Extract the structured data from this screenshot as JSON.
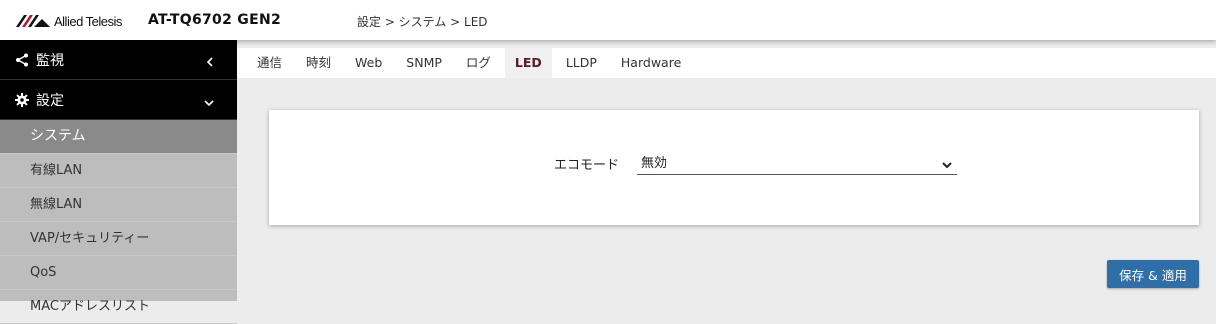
{
  "header": {
    "logo_text": "Allied Telesis",
    "model": "AT-TQ6702 GEN2",
    "breadcrumb": "設定 > システム > LED"
  },
  "sidebar": {
    "groups": [
      {
        "label": "監視",
        "icon": "share-icon",
        "chevron": "chevron-left-icon"
      },
      {
        "label": "設定",
        "icon": "gear-icon",
        "chevron": "chevron-down-icon"
      }
    ],
    "items": [
      {
        "label": "システム",
        "active": true
      },
      {
        "label": "有線LAN"
      },
      {
        "label": "無線LAN"
      },
      {
        "label": "VAP/セキュリティー"
      },
      {
        "label": "QoS"
      },
      {
        "label": "MACアドレスリスト"
      }
    ]
  },
  "tabs": [
    {
      "label": "通信"
    },
    {
      "label": "時刻"
    },
    {
      "label": "Web"
    },
    {
      "label": "SNMP"
    },
    {
      "label": "ログ"
    },
    {
      "label": "LED",
      "active": true
    },
    {
      "label": "LLDP"
    },
    {
      "label": "Hardware"
    }
  ],
  "form": {
    "eco_mode_label": "エコモード",
    "eco_mode_value": "無効"
  },
  "actions": {
    "save_label": "保存 & 適用"
  },
  "colors": {
    "accent": "#2f6fa8",
    "sidebar_group_bg": "#000000",
    "sidebar_active_bg": "#8a8a8a",
    "active_tab_text": "#5a1a2a"
  }
}
